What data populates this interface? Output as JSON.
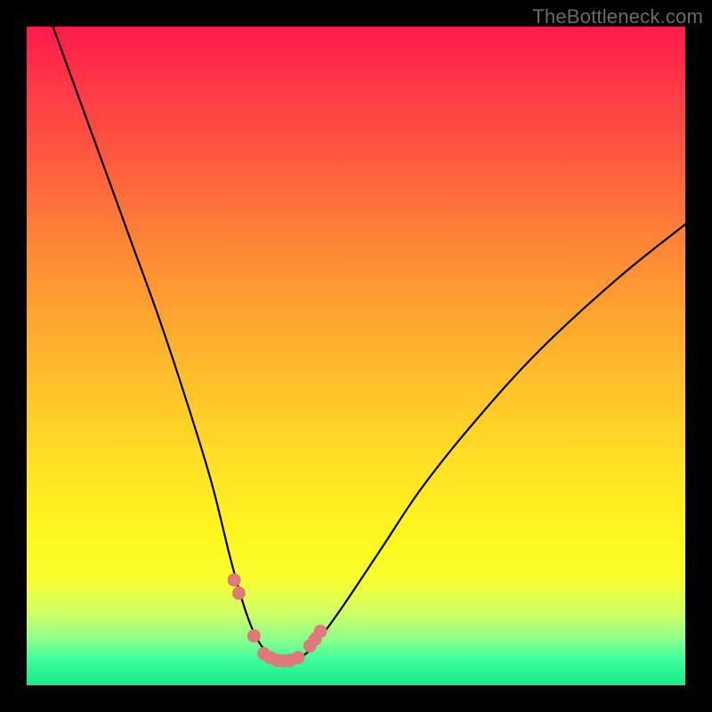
{
  "watermark": "TheBottleneck.com",
  "chart_data": {
    "type": "line",
    "title": "",
    "xlabel": "",
    "ylabel": "",
    "xlim": [
      0,
      100
    ],
    "ylim": [
      0,
      100
    ],
    "series": [
      {
        "name": "bottleneck-curve",
        "x": [
          4,
          8,
          12,
          16,
          20,
          24,
          28,
          31,
          33,
          34.5,
          36,
          37.5,
          39,
          40.5,
          42,
          44,
          48,
          54,
          60,
          68,
          78,
          90,
          100
        ],
        "y": [
          100,
          89,
          78,
          67,
          56,
          44,
          31,
          19,
          12,
          8,
          5.5,
          4.2,
          3.7,
          3.8,
          4.5,
          6.5,
          12,
          21,
          30,
          40,
          51,
          62,
          70
        ]
      }
    ],
    "markers": {
      "name": "highlight-points",
      "color": "#e07a7a",
      "x": [
        31.5,
        32.2,
        34.5,
        36.0,
        37.0,
        38.0,
        39.0,
        40.0,
        41.2,
        43.0,
        43.8,
        44.6
      ],
      "y": [
        16.0,
        14.0,
        7.5,
        4.8,
        4.2,
        3.8,
        3.7,
        3.8,
        4.2,
        6.0,
        7.0,
        8.2
      ]
    },
    "background_gradient": {
      "top": "#ff1a4d",
      "middle": "#ffe524",
      "bottom": "#19e889"
    }
  }
}
